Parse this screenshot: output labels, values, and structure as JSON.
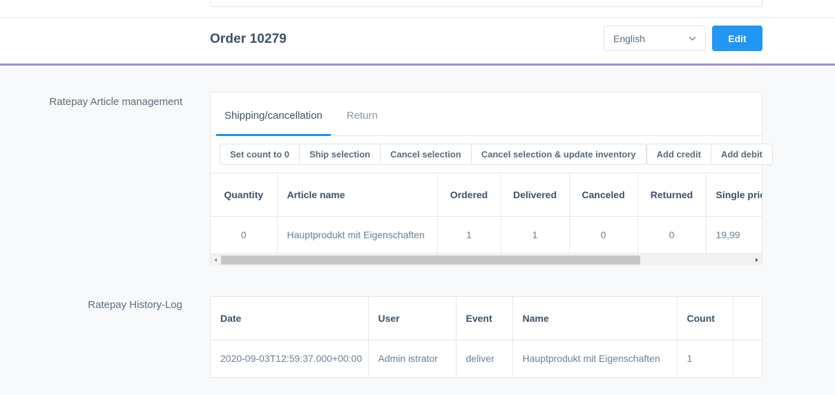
{
  "header": {
    "order_title": "Order 10279",
    "language_value": "English",
    "edit_label": "Edit",
    "chevron_icon": "chevron-down-icon"
  },
  "sections": {
    "article_management_label": "Ratepay Article management",
    "history_log_label": "Ratepay History-Log"
  },
  "tabs": [
    {
      "label": "Shipping/cancellation",
      "active": true
    },
    {
      "label": "Return",
      "active": false
    }
  ],
  "toolbar": {
    "group_one": [
      "Set count to 0",
      "Ship selection",
      "Cancel selection",
      "Cancel selection & update inventory"
    ],
    "group_two": [
      "Add credit",
      "Add debit"
    ]
  },
  "article_table": {
    "columns": [
      "Quantity",
      "Article name",
      "Ordered",
      "Delivered",
      "Canceled",
      "Returned",
      "Single price"
    ],
    "rows": [
      {
        "quantity": "0",
        "article_name": "Hauptprodukt mit Eigenschaften",
        "ordered": "1",
        "delivered": "1",
        "canceled": "0",
        "returned": "0",
        "single_price": "19,99"
      }
    ],
    "scrollbar": {
      "left_arrow_icon": "triangle-left-icon",
      "right_arrow_icon": "triangle-right-icon",
      "thumb_position_percent": 0
    }
  },
  "history_table": {
    "columns": [
      "Date",
      "User",
      "Event",
      "Name",
      "Count",
      ""
    ],
    "rows": [
      {
        "date": "2020-09-03T12:59:37.000+00:00",
        "user": "Admin istrator",
        "event": "deliver",
        "name": "Hauptprodukt mit Eigenschaften",
        "count": "1",
        "extra": ""
      }
    ]
  },
  "colors": {
    "accent_blue": "#2196f3",
    "tab_underline": "#1e90f0",
    "divider_purple": "#9b8ce8",
    "body_background": "#f7f9fb",
    "heading_text": "#3c5168",
    "cell_text": "#6b7f93",
    "border": "#e3e8ee"
  }
}
